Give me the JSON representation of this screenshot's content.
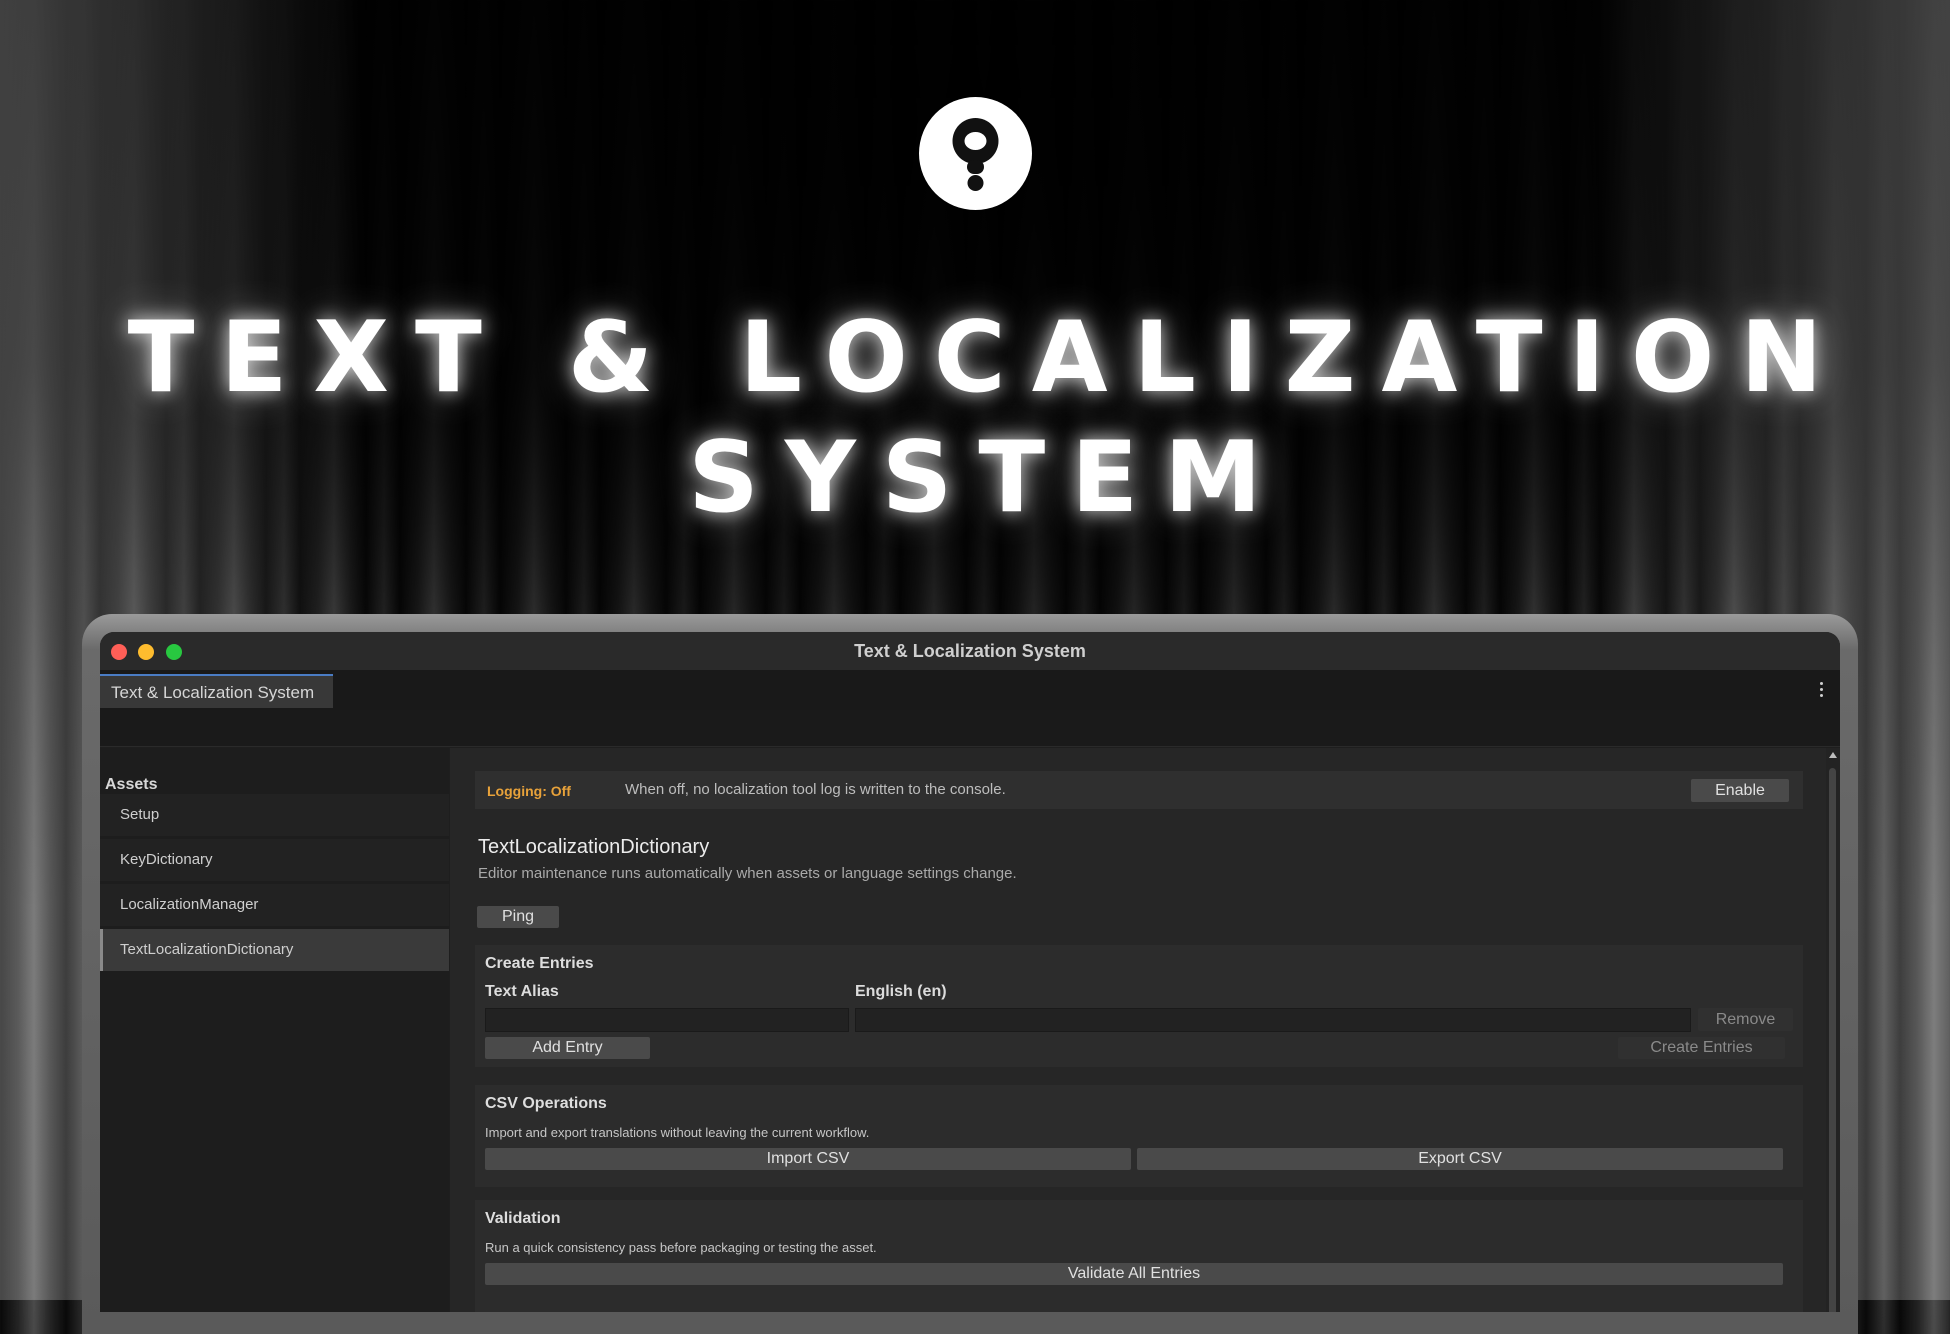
{
  "hero": {
    "logo_icon": "keyhole-logo-icon",
    "title_line1": "TEXT & LOCALIZATION",
    "title_line2": "SYSTEM"
  },
  "window": {
    "title": "Text & Localization System",
    "tab_label": "Text & Localization System",
    "menu_icon": "kebab-menu-icon"
  },
  "sidebar": {
    "header": "Assets",
    "items": [
      {
        "label": "Setup"
      },
      {
        "label": "KeyDictionary"
      },
      {
        "label": "LocalizationManager"
      },
      {
        "label": "TextLocalizationDictionary",
        "active": true
      }
    ]
  },
  "logging": {
    "label": "Logging: Off",
    "description": "When off, no localization tool log is written to the console.",
    "enable_label": "Enable",
    "label_color": "#e8a23a"
  },
  "asset": {
    "title": "TextLocalizationDictionary",
    "subtitle": "Editor maintenance runs automatically when assets or language settings change.",
    "ping_label": "Ping"
  },
  "create_entries": {
    "title": "Create Entries",
    "col_alias": "Text Alias",
    "col_english": "English (en)",
    "alias_value": "",
    "english_value": "",
    "remove_label": "Remove",
    "add_entry_label": "Add Entry",
    "create_entries_label": "Create Entries"
  },
  "csv": {
    "title": "CSV Operations",
    "note": "Import and export translations without leaving the current workflow.",
    "import_label": "Import CSV",
    "export_label": "Export CSV"
  },
  "validation": {
    "title": "Validation",
    "note": "Run a quick consistency pass before packaging or testing the asset.",
    "validate_label": "Validate All Entries"
  }
}
